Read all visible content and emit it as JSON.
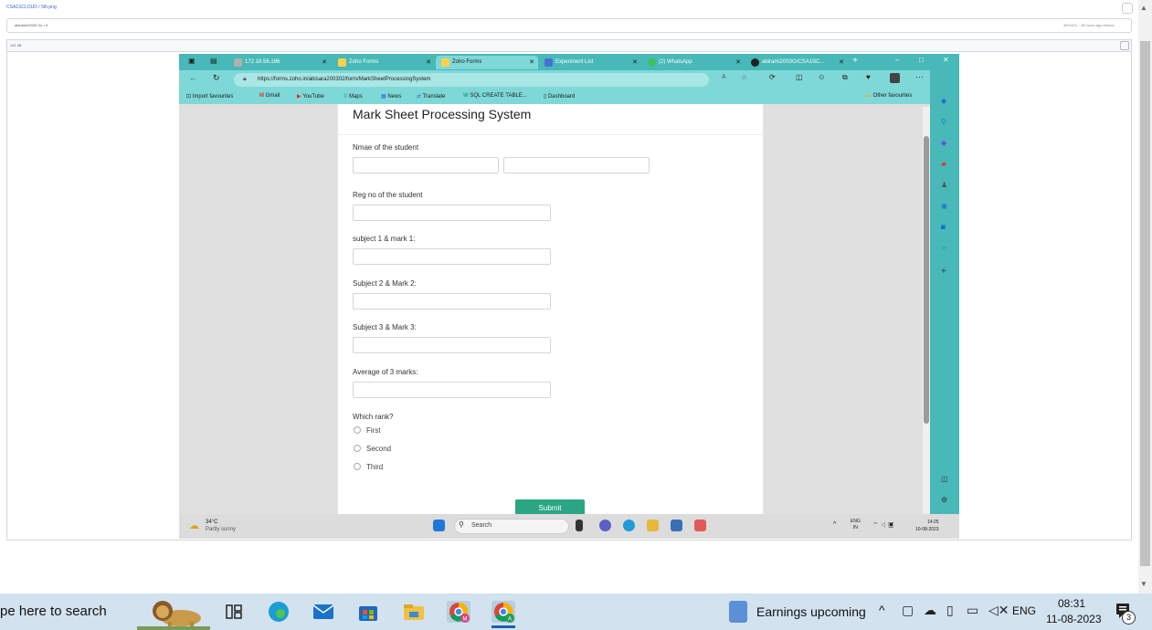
{
  "outer": {
    "file_title": "CSA1SCLOUD / 5th.png",
    "commit_author": "abirami2003G  5c • 5",
    "commit_right": "487ed7c · 18 hours ago   History",
    "file_info": "141 kB"
  },
  "browser": {
    "tabs": [
      {
        "label": "172.18.56.186"
      },
      {
        "label": "Zoho Forms"
      },
      {
        "label": "Zoho Forms"
      },
      {
        "label": "Experiment List"
      },
      {
        "label": "(2) WhatsApp"
      },
      {
        "label": "abirami2003G/CSA1SC..."
      }
    ],
    "url": "https://forms.zoho.in/abisara200302/form/MarkSheetProcessingSystem",
    "favourites": [
      {
        "label": "Import favourites"
      },
      {
        "label": "Gmail"
      },
      {
        "label": "YouTube"
      },
      {
        "label": "Maps"
      },
      {
        "label": "News"
      },
      {
        "label": "Translate"
      },
      {
        "label": "SQL CREATE TABLE..."
      },
      {
        "label": "Dashboard"
      },
      {
        "label": "Other favourites"
      }
    ]
  },
  "form": {
    "title": "Mark Sheet Processing System",
    "name_label": "Nmae of the student",
    "reg_label": "Reg no of the student",
    "subject1_label": "subject 1 & mark 1:",
    "subject2_label": "Subject 2 & Mark 2:",
    "subject3_label": "Subject 3 & Mark 3:",
    "average_label": "Average of 3 marks:",
    "rank_label": "Which rank?",
    "rank_options": [
      {
        "label": "First"
      },
      {
        "label": "Second"
      },
      {
        "label": "Third"
      }
    ],
    "submit_label": "Submit"
  },
  "inner_taskbar": {
    "temp": "34°C",
    "weather": "Partly sunny",
    "search": "Search",
    "lang_top": "ENG",
    "lang_bottom": "IN",
    "time": "14:25",
    "date": "10-08-2023"
  },
  "taskbar": {
    "search_text": "pe here to search",
    "earnings": "Earnings upcoming",
    "lang": "ENG",
    "time": "08:31",
    "date": "11-08-2023",
    "notification_count": "3"
  }
}
